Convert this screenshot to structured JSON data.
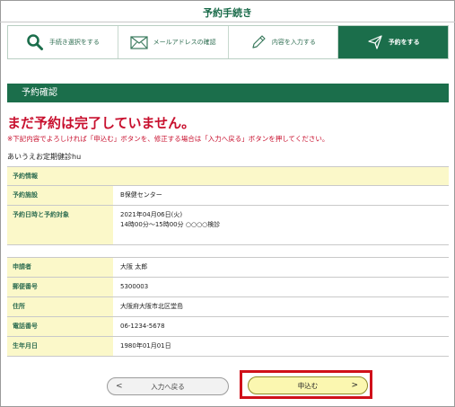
{
  "header": {
    "title": "予約手続き"
  },
  "steps": [
    {
      "label": "手続き選択をする",
      "icon": "search-icon"
    },
    {
      "label": "メールアドレスの確認",
      "icon": "envelope-icon"
    },
    {
      "label": "内容を入力する",
      "icon": "pencil-icon"
    },
    {
      "label": "予約をする",
      "icon": "send-icon",
      "active": true
    }
  ],
  "section": {
    "title": "予約確認"
  },
  "warning": {
    "title": "まだ予約は完了していません。",
    "note": "※下記内容でよろしければ「申込む」ボタンを、修正する場合は「入力へ戻る」ボタンを押してください。"
  },
  "menu_name": "あいうえお定期健診hu",
  "reservation": {
    "header": "予約情報",
    "rows": [
      {
        "label": "予約施設",
        "value": "B保健センター"
      },
      {
        "label": "予約日時と予約対象",
        "value": "2021年04月06日(火)",
        "value2": "14時00分～15時00分 ○○○○検診"
      }
    ]
  },
  "applicant": {
    "rows": [
      {
        "label": "申請者",
        "value": "大阪 太郎"
      },
      {
        "label": "郵便番号",
        "value": "5300003"
      },
      {
        "label": "住所",
        "value": "大阪府大阪市北区堂島"
      },
      {
        "label": "電話番号",
        "value": "06-1234-5678"
      },
      {
        "label": "生年月日",
        "value": "1980年01月01日"
      }
    ]
  },
  "buttons": {
    "back": "入力へ戻る",
    "submit": "申込む",
    "back_arrow": "<",
    "submit_arrow": ">"
  },
  "colors": {
    "brand": "#1b6e4b",
    "warning": "#c8102e",
    "label_bg": "#fbf8c9",
    "highlight": "#d0101a"
  }
}
